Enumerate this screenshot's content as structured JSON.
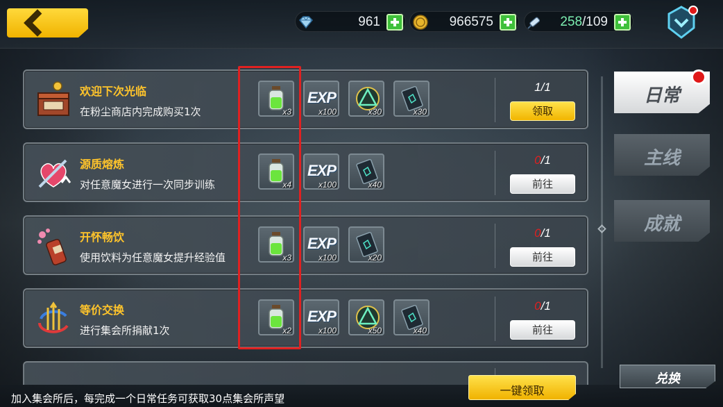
{
  "resources": {
    "diamond": "961",
    "gold": "966575",
    "stamina_current": "258",
    "stamina_sep": "/",
    "stamina_max": "109"
  },
  "tasks": [
    {
      "title": "欢迎下次光临",
      "desc": "在粉尘商店内完成购买1次",
      "progress_done": "1",
      "progress_total": "/1",
      "button": "领取",
      "button_type": "claim",
      "rewards": [
        {
          "icon": "green-potion-icon",
          "count": "x3"
        },
        {
          "icon": "exp-icon",
          "count": "x100"
        },
        {
          "icon": "emblem-icon",
          "count": "x30"
        },
        {
          "icon": "card-icon",
          "count": "x30"
        }
      ]
    },
    {
      "title": "源质熔炼",
      "desc": "对任意魔女进行一次同步训练",
      "progress_done": "0",
      "progress_total": "/1",
      "button": "前往",
      "button_type": "go",
      "rewards": [
        {
          "icon": "green-potion-icon",
          "count": "x4"
        },
        {
          "icon": "exp-icon",
          "count": "x100"
        },
        {
          "icon": "card-icon",
          "count": "x40"
        }
      ]
    },
    {
      "title": "开怀畅饮",
      "desc": "使用饮料为任意魔女提升经验值",
      "progress_done": "0",
      "progress_total": "/1",
      "button": "前往",
      "button_type": "go",
      "rewards": [
        {
          "icon": "green-potion-icon",
          "count": "x3"
        },
        {
          "icon": "exp-icon",
          "count": "x100"
        },
        {
          "icon": "card-icon",
          "count": "x20"
        }
      ]
    },
    {
      "title": "等价交换",
      "desc": "进行集会所捐献1次",
      "progress_done": "0",
      "progress_total": "/1",
      "button": "前往",
      "button_type": "go",
      "rewards": [
        {
          "icon": "green-potion-icon",
          "count": "x2"
        },
        {
          "icon": "exp-icon",
          "count": "x100"
        },
        {
          "icon": "emblem-icon",
          "count": "x50"
        },
        {
          "icon": "card-icon",
          "count": "x40"
        }
      ]
    }
  ],
  "exp_label": "EXP",
  "tabs": [
    {
      "label": "日常",
      "active": true
    },
    {
      "label": "主线",
      "active": false
    },
    {
      "label": "成就",
      "active": false
    }
  ],
  "exchange_label": "兑换",
  "claim_all_label": "一键领取",
  "footer_note": "加入集会所后，每完成一个日常任务可获取30点集会所声望",
  "colors": {
    "accent_yellow": "#f0b300",
    "title_yellow": "#ffc42b",
    "highlight_red": "#e02121",
    "progress_zero": "#e02020"
  }
}
